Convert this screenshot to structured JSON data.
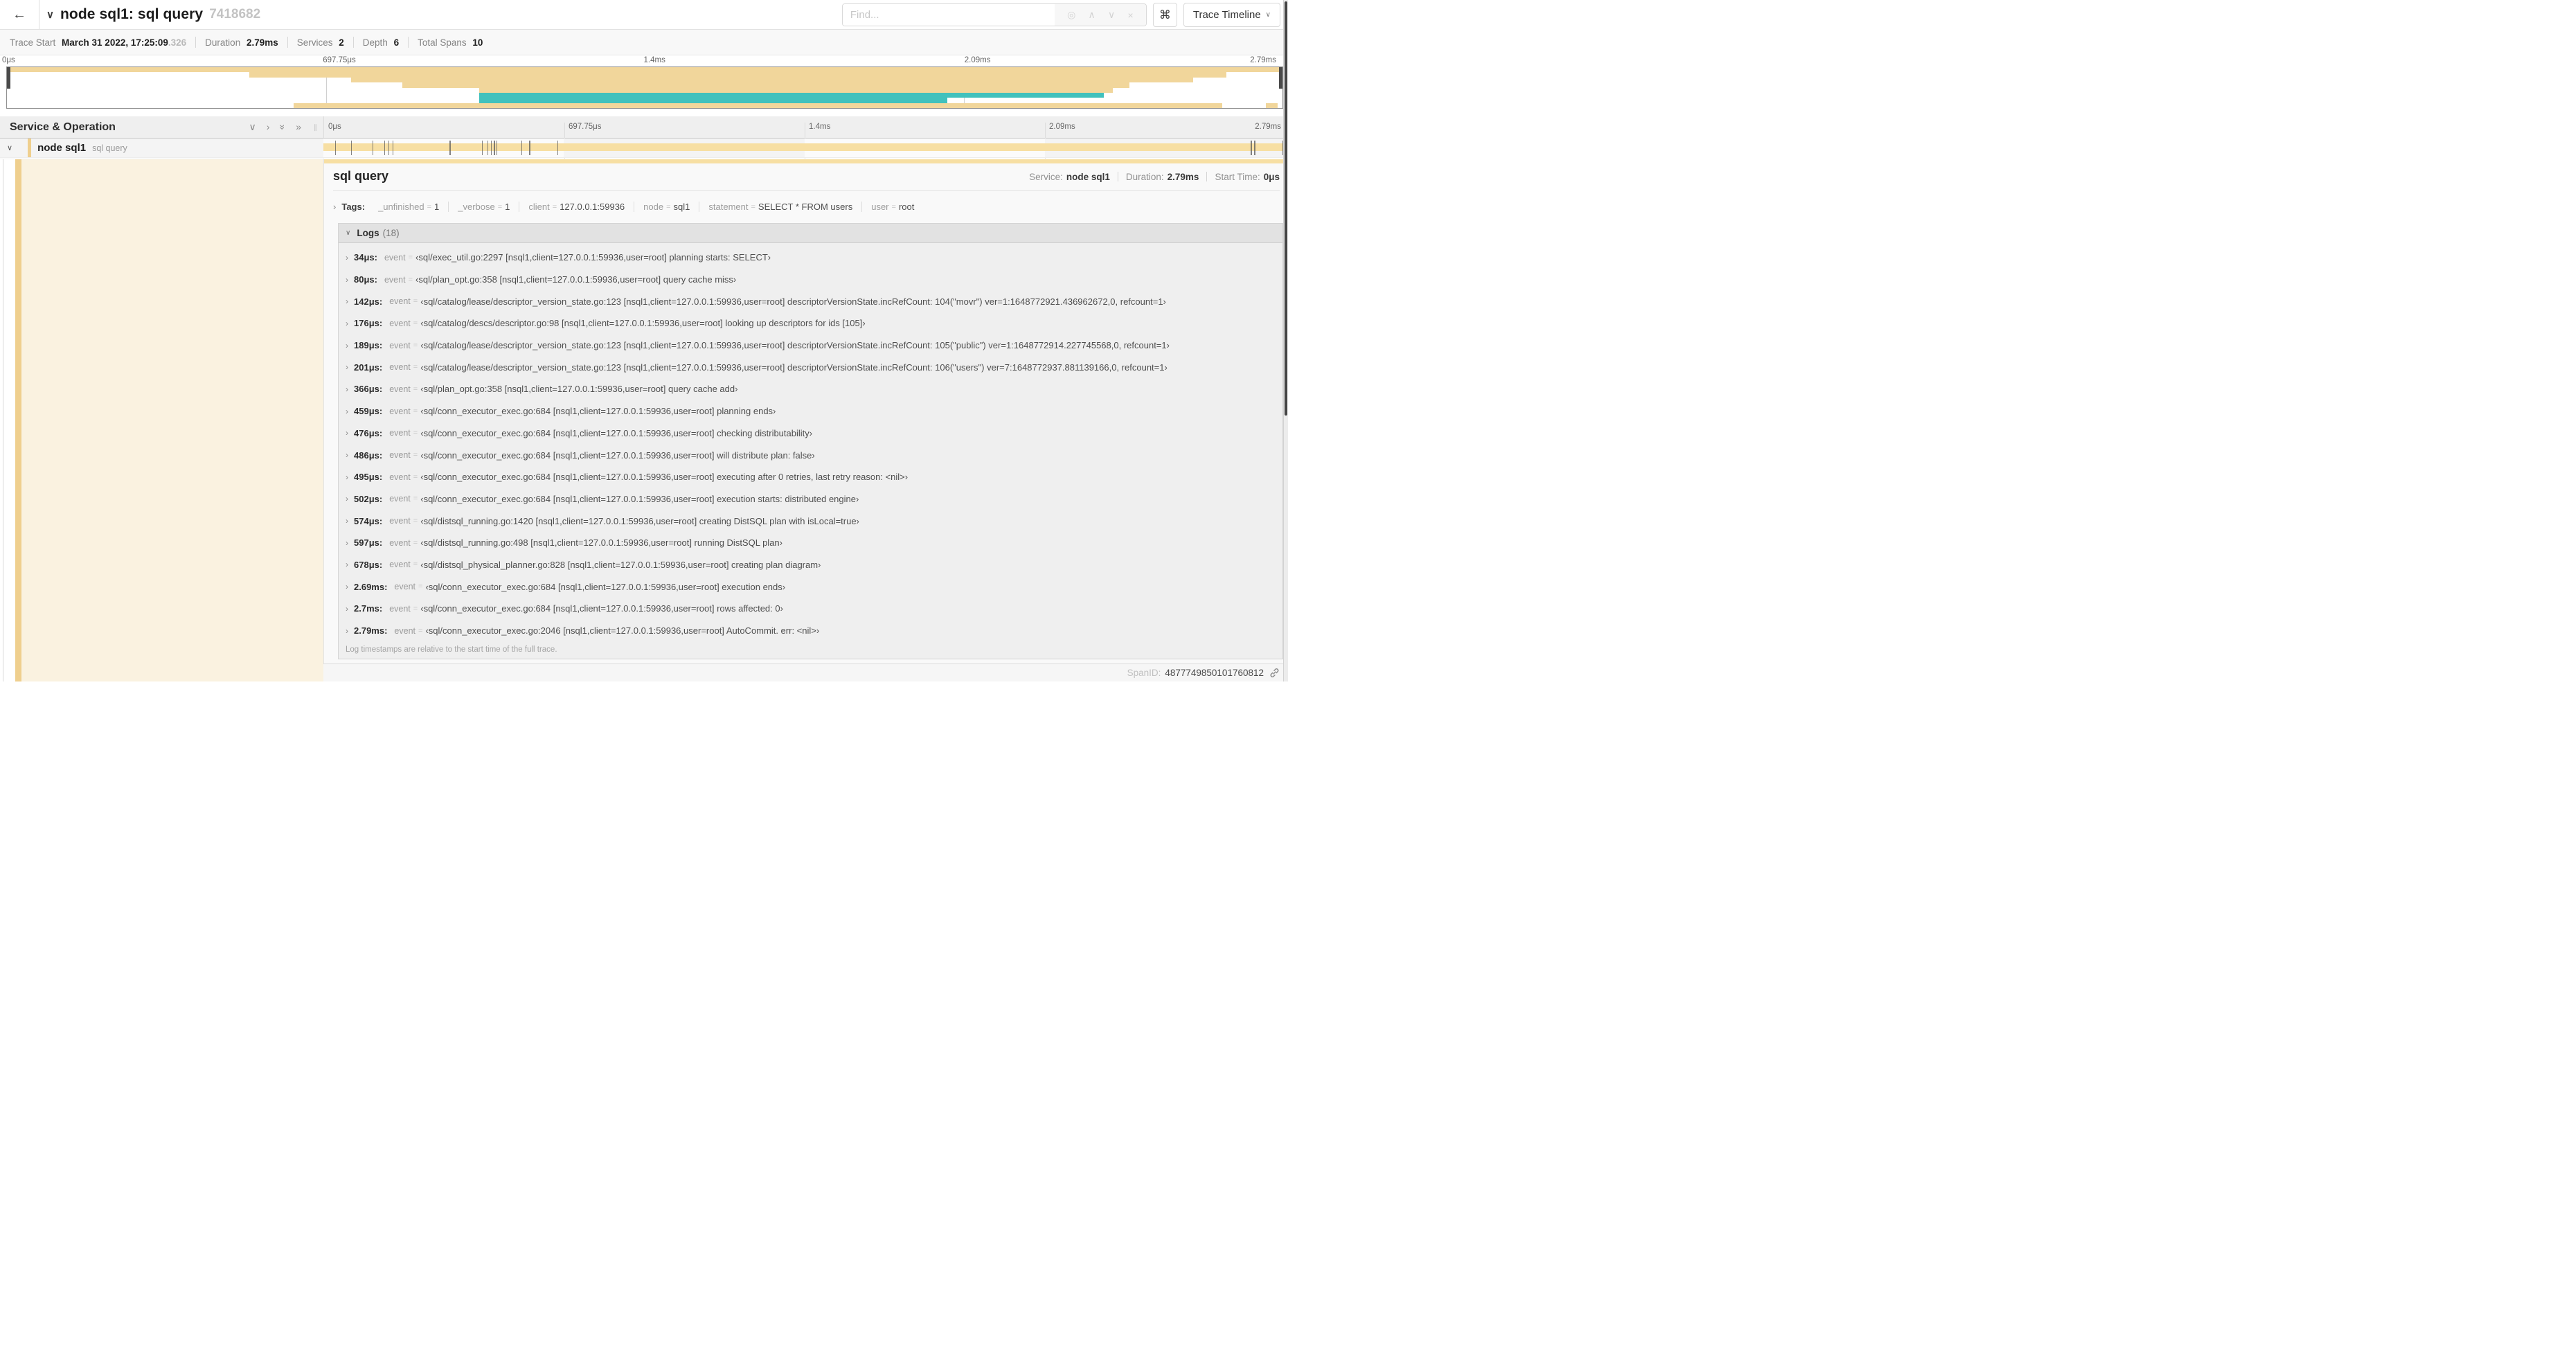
{
  "colors": {
    "tan": "#f1d69b",
    "tan_bar": "#f7dfa3",
    "tan_strip": "#efcf8e",
    "teal": "#41c1bd",
    "cream": "#faf2e0"
  },
  "icons": {
    "back": "←",
    "chevron_down": "∨",
    "chevron_right": "›",
    "double_chevron_right": "»",
    "find_target": "◎",
    "find_up": "∧",
    "find_down": "∨",
    "find_close": "×",
    "cmd": "⌘",
    "resize_grip": "∥"
  },
  "header": {
    "title": "node sql1: sql query",
    "trace_id": "7418682",
    "find_placeholder": "Find...",
    "view_select_label": "Trace Timeline"
  },
  "summary": {
    "items": [
      {
        "label": "Trace Start",
        "value": "March 31 2022, 17:25:09",
        "muted": ".326"
      },
      {
        "label": "Duration",
        "value": "2.79ms"
      },
      {
        "label": "Services",
        "value": "2"
      },
      {
        "label": "Depth",
        "value": "6"
      },
      {
        "label": "Total Spans",
        "value": "10"
      }
    ]
  },
  "timeline": {
    "duration_us": 2790,
    "tick_labels": [
      "0μs",
      "697.75μs",
      "1.4ms",
      "2.09ms",
      "2.79ms"
    ],
    "minimap_spans": [
      {
        "start": 0,
        "end": 100,
        "color": "tan"
      },
      {
        "start": 19,
        "end": 95.6,
        "color": "tan"
      },
      {
        "start": 27,
        "end": 93,
        "color": "tan"
      },
      {
        "start": 31,
        "end": 88,
        "color": "tan"
      },
      {
        "start": 37,
        "end": 86.7,
        "color": "tan"
      },
      {
        "start": 37,
        "end": 86,
        "color": "teal"
      },
      {
        "start": 37,
        "end": 73.7,
        "color": "teal"
      },
      {
        "start": 22.5,
        "end": 95.3,
        "color": "tan"
      },
      {
        "start": 98.7,
        "end": 99.6,
        "color": "tan"
      }
    ]
  },
  "grid": {
    "left_header": "Service & Operation"
  },
  "span_row": {
    "service": "node sql1",
    "operation": "sql query"
  },
  "detail": {
    "title": "sql query",
    "meta": [
      {
        "label": "Service:",
        "value": "node sql1"
      },
      {
        "label": "Duration:",
        "value": "2.79ms"
      },
      {
        "label": "Start Time:",
        "value": "0μs"
      }
    ],
    "tags_label": "Tags:",
    "tags": [
      {
        "key": "_unfinished",
        "value": "1"
      },
      {
        "key": "_verbose",
        "value": "1"
      },
      {
        "key": "client",
        "value": "127.0.0.1:59936"
      },
      {
        "key": "node",
        "value": "sql1"
      },
      {
        "key": "statement",
        "value": "SELECT * FROM users"
      },
      {
        "key": "user",
        "value": "root"
      }
    ],
    "logs_label": "Logs",
    "logs_count": "(18)",
    "log_key": "event",
    "logs": [
      {
        "t": 34,
        "time": "34μs:",
        "value": "‹sql/exec_util.go:2297 [nsql1,client=127.0.0.1:59936,user=root] planning starts: SELECT›"
      },
      {
        "t": 80,
        "time": "80μs:",
        "value": "‹sql/plan_opt.go:358 [nsql1,client=127.0.0.1:59936,user=root] query cache miss›"
      },
      {
        "t": 142,
        "time": "142μs:",
        "value": "‹sql/catalog/lease/descriptor_version_state.go:123 [nsql1,client=127.0.0.1:59936,user=root] descriptorVersionState.incRefCount: 104(\"movr\") ver=1:1648772921.436962672,0, refcount=1›"
      },
      {
        "t": 176,
        "time": "176μs:",
        "value": "‹sql/catalog/descs/descriptor.go:98 [nsql1,client=127.0.0.1:59936,user=root] looking up descriptors for ids [105]›"
      },
      {
        "t": 189,
        "time": "189μs:",
        "value": "‹sql/catalog/lease/descriptor_version_state.go:123 [nsql1,client=127.0.0.1:59936,user=root] descriptorVersionState.incRefCount: 105(\"public\") ver=1:1648772914.227745568,0, refcount=1›"
      },
      {
        "t": 201,
        "time": "201μs:",
        "value": "‹sql/catalog/lease/descriptor_version_state.go:123 [nsql1,client=127.0.0.1:59936,user=root] descriptorVersionState.incRefCount: 106(\"users\") ver=7:1648772937.881139166,0, refcount=1›"
      },
      {
        "t": 366,
        "time": "366μs:",
        "value": "‹sql/plan_opt.go:358 [nsql1,client=127.0.0.1:59936,user=root] query cache add›"
      },
      {
        "t": 459,
        "time": "459μs:",
        "value": "‹sql/conn_executor_exec.go:684 [nsql1,client=127.0.0.1:59936,user=root] planning ends›"
      },
      {
        "t": 476,
        "time": "476μs:",
        "value": "‹sql/conn_executor_exec.go:684 [nsql1,client=127.0.0.1:59936,user=root] checking distributability›"
      },
      {
        "t": 486,
        "time": "486μs:",
        "value": "‹sql/conn_executor_exec.go:684 [nsql1,client=127.0.0.1:59936,user=root] will distribute plan: false›"
      },
      {
        "t": 495,
        "time": "495μs:",
        "value": "‹sql/conn_executor_exec.go:684 [nsql1,client=127.0.0.1:59936,user=root] executing after 0 retries, last retry reason: <nil>›"
      },
      {
        "t": 502,
        "time": "502μs:",
        "value": "‹sql/conn_executor_exec.go:684 [nsql1,client=127.0.0.1:59936,user=root] execution starts: distributed engine›"
      },
      {
        "t": 574,
        "time": "574μs:",
        "value": "‹sql/distsql_running.go:1420 [nsql1,client=127.0.0.1:59936,user=root] creating DistSQL plan with isLocal=true›"
      },
      {
        "t": 597,
        "time": "597μs:",
        "value": "‹sql/distsql_running.go:498 [nsql1,client=127.0.0.1:59936,user=root] running DistSQL plan›"
      },
      {
        "t": 678,
        "time": "678μs:",
        "value": "‹sql/distsql_physical_planner.go:828 [nsql1,client=127.0.0.1:59936,user=root] creating plan diagram›"
      },
      {
        "t": 2690,
        "time": "2.69ms:",
        "value": "‹sql/conn_executor_exec.go:684 [nsql1,client=127.0.0.1:59936,user=root] execution ends›"
      },
      {
        "t": 2700,
        "time": "2.7ms:",
        "value": "‹sql/conn_executor_exec.go:684 [nsql1,client=127.0.0.1:59936,user=root] rows affected: 0›"
      },
      {
        "t": 2790,
        "time": "2.79ms:",
        "value": "‹sql/conn_executor_exec.go:2046 [nsql1,client=127.0.0.1:59936,user=root] AutoCommit. err: <nil>›"
      }
    ],
    "logs_note": "Log timestamps are relative to the start time of the full trace.",
    "spanid_label": "SpanID:",
    "spanid": "4877749850101760812"
  }
}
